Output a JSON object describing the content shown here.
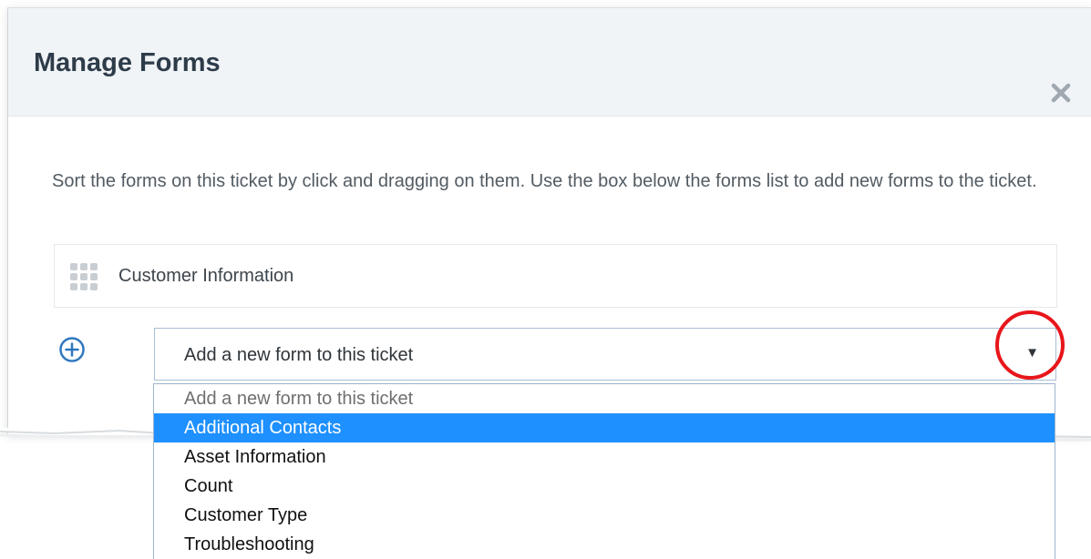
{
  "dialog": {
    "title": "Manage Forms",
    "close_label": "close"
  },
  "instructions": "Sort the forms on this ticket by click and dragging on them. Use the box below the forms list to add new forms to the ticket.",
  "form_list": [
    {
      "label": "Customer Information",
      "icon": "drag-handle-icon"
    }
  ],
  "add_form": {
    "icon": "add-circle-icon",
    "select_value": "Add a new form to this ticket",
    "caret": "▼",
    "highlight_color": "#e8161b"
  },
  "dropdown": {
    "options": [
      {
        "label": "Add a new form to this ticket",
        "state": "placeholder"
      },
      {
        "label": "Additional Contacts",
        "state": "selected"
      },
      {
        "label": "Asset Information",
        "state": ""
      },
      {
        "label": "Count",
        "state": ""
      },
      {
        "label": "Customer Type",
        "state": ""
      },
      {
        "label": "Troubleshooting",
        "state": ""
      }
    ],
    "selected_color": "#1e90ff"
  },
  "colors": {
    "header_bg": "#f1f4f7",
    "title": "#2e3c4a",
    "accent_icon": "#2f78bf"
  }
}
